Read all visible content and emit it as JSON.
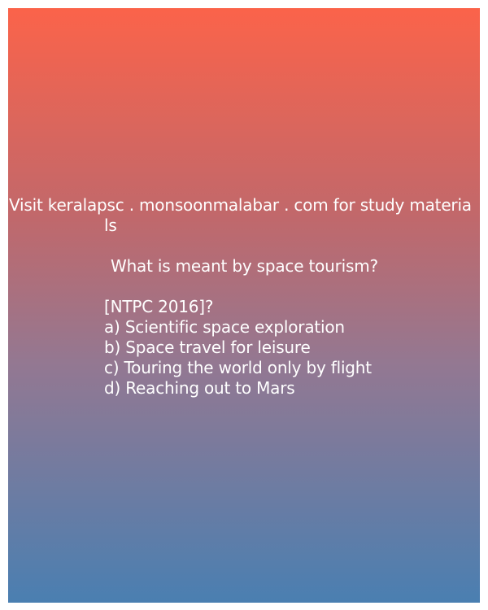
{
  "banner": {
    "visit_line": "Visit keralapsc . monsoonmalabar . com for study materia",
    "visit_line_wrap": "ls"
  },
  "question": {
    "text": "What is meant by space tourism?",
    "exam_tag": "[NTPC 2016]?",
    "options": [
      "a) Scientific space exploration",
      "b) Space travel for leisure",
      "c) Touring the world only by flight",
      "d) Reaching out to Mars"
    ]
  },
  "colors": {
    "gradient_top": "#fb634a",
    "gradient_bottom": "#4a7fb1",
    "text": "#ffffff"
  }
}
